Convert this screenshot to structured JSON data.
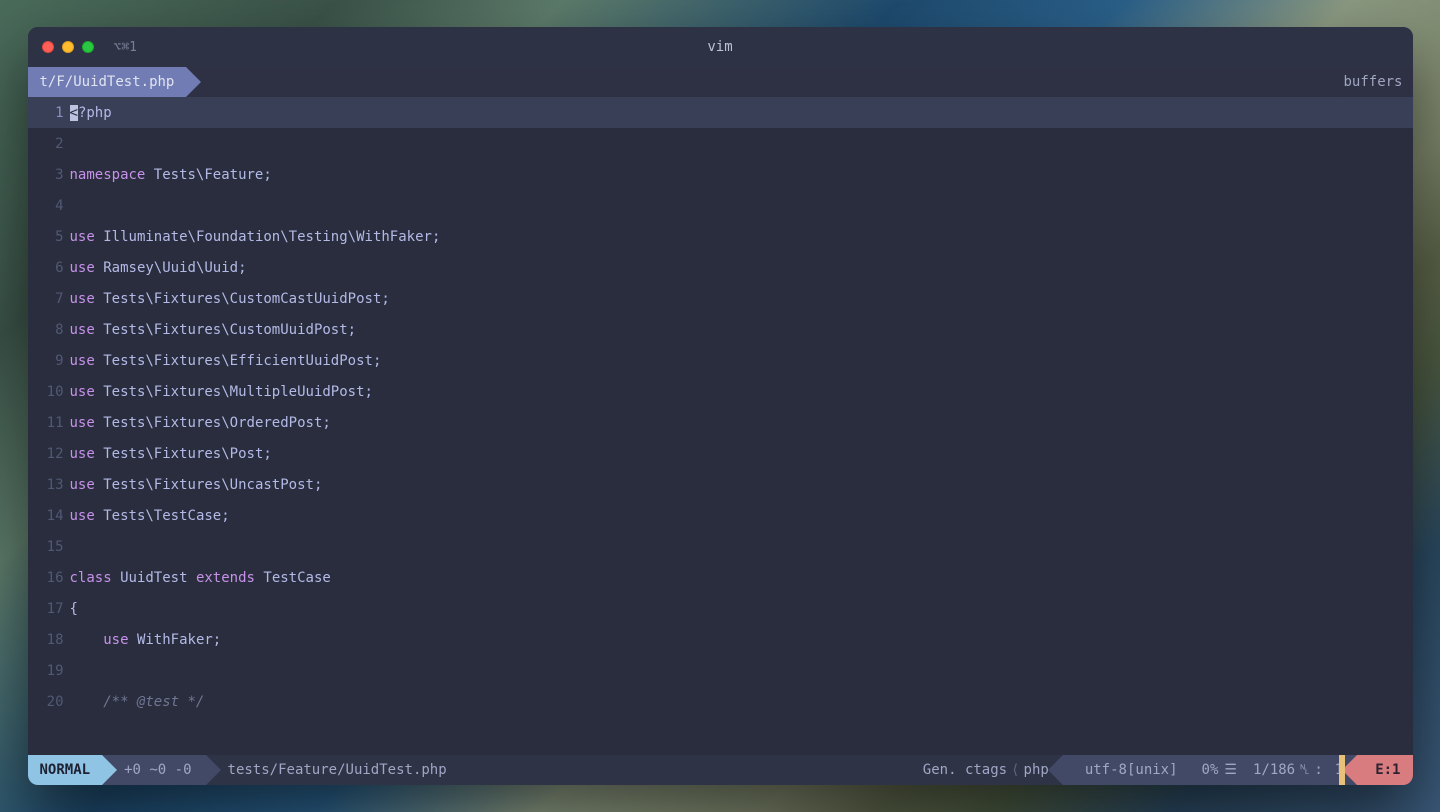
{
  "window": {
    "hotkey": "⌥⌘1",
    "title": "vim"
  },
  "tabline": {
    "active_tab": "t/F/UuidTest.php",
    "right_label": "buffers"
  },
  "code": {
    "lines": [
      {
        "num": "1",
        "tokens": [
          {
            "cls": "cursor-bg",
            "txt": "<"
          },
          {
            "cls": "",
            "txt": "?php"
          }
        ],
        "current": true
      },
      {
        "num": "2",
        "tokens": [
          {
            "cls": "",
            "txt": ""
          }
        ]
      },
      {
        "num": "3",
        "tokens": [
          {
            "cls": "kw-ns",
            "txt": "namespace"
          },
          {
            "cls": "",
            "txt": " Tests\\Feature;"
          }
        ]
      },
      {
        "num": "4",
        "tokens": [
          {
            "cls": "",
            "txt": ""
          }
        ]
      },
      {
        "num": "5",
        "tokens": [
          {
            "cls": "kw-use",
            "txt": "use"
          },
          {
            "cls": "",
            "txt": " Illuminate\\Foundation\\Testing\\WithFaker;"
          }
        ]
      },
      {
        "num": "6",
        "tokens": [
          {
            "cls": "kw-use",
            "txt": "use"
          },
          {
            "cls": "",
            "txt": " Ramsey\\Uuid\\Uuid;"
          }
        ]
      },
      {
        "num": "7",
        "tokens": [
          {
            "cls": "kw-use",
            "txt": "use"
          },
          {
            "cls": "",
            "txt": " Tests\\Fixtures\\CustomCastUuidPost;"
          }
        ]
      },
      {
        "num": "8",
        "tokens": [
          {
            "cls": "kw-use",
            "txt": "use"
          },
          {
            "cls": "",
            "txt": " Tests\\Fixtures\\CustomUuidPost;"
          }
        ]
      },
      {
        "num": "9",
        "tokens": [
          {
            "cls": "kw-use",
            "txt": "use"
          },
          {
            "cls": "",
            "txt": " Tests\\Fixtures\\EfficientUuidPost;"
          }
        ]
      },
      {
        "num": "10",
        "tokens": [
          {
            "cls": "kw-use",
            "txt": "use"
          },
          {
            "cls": "",
            "txt": " Tests\\Fixtures\\MultipleUuidPost;"
          }
        ]
      },
      {
        "num": "11",
        "tokens": [
          {
            "cls": "kw-use",
            "txt": "use"
          },
          {
            "cls": "",
            "txt": " Tests\\Fixtures\\OrderedPost;"
          }
        ]
      },
      {
        "num": "12",
        "tokens": [
          {
            "cls": "kw-use",
            "txt": "use"
          },
          {
            "cls": "",
            "txt": " Tests\\Fixtures\\Post;"
          }
        ]
      },
      {
        "num": "13",
        "tokens": [
          {
            "cls": "kw-use",
            "txt": "use"
          },
          {
            "cls": "",
            "txt": " Tests\\Fixtures\\UncastPost;"
          }
        ]
      },
      {
        "num": "14",
        "tokens": [
          {
            "cls": "kw-use",
            "txt": "use"
          },
          {
            "cls": "",
            "txt": " Tests\\TestCase;"
          }
        ]
      },
      {
        "num": "15",
        "tokens": [
          {
            "cls": "",
            "txt": ""
          }
        ]
      },
      {
        "num": "16",
        "tokens": [
          {
            "cls": "kw-class",
            "txt": "class"
          },
          {
            "cls": "",
            "txt": " UuidTest "
          },
          {
            "cls": "kw-extends",
            "txt": "extends"
          },
          {
            "cls": "",
            "txt": " TestCase"
          }
        ]
      },
      {
        "num": "17",
        "tokens": [
          {
            "cls": "",
            "txt": "{"
          }
        ]
      },
      {
        "num": "18",
        "tokens": [
          {
            "cls": "",
            "txt": "    "
          },
          {
            "cls": "kw-use",
            "txt": "use"
          },
          {
            "cls": "",
            "txt": " WithFaker;"
          }
        ]
      },
      {
        "num": "19",
        "tokens": [
          {
            "cls": "",
            "txt": ""
          }
        ]
      },
      {
        "num": "20",
        "tokens": [
          {
            "cls": "comment",
            "txt": "    /** @test */"
          }
        ]
      }
    ]
  },
  "statusline": {
    "mode": "NORMAL",
    "git": "+0 ~0 -0",
    "filepath": "tests/Feature/UuidTest.php",
    "ctags": "Gen. ctags",
    "filetype": "php",
    "encoding": "utf-8[unix]",
    "percent": "0%",
    "position": "1/186",
    "col_sep": ":",
    "col": "1",
    "errors": "E:1"
  }
}
